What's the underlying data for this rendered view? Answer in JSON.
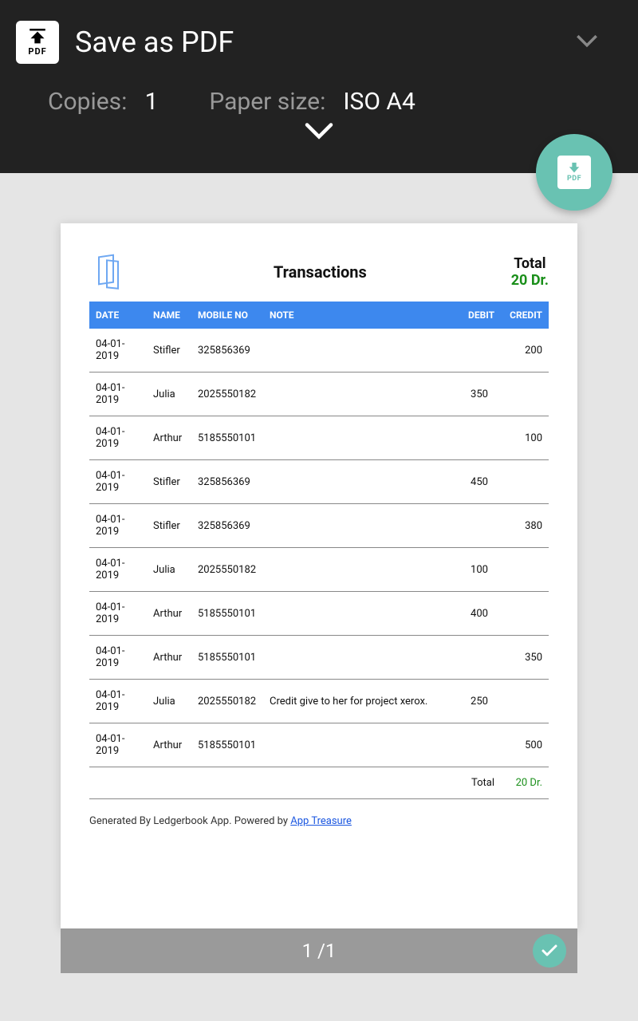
{
  "header": {
    "title": "Save as PDF",
    "copies_label": "Copies:",
    "copies_value": "1",
    "paper_label": "Paper size:",
    "paper_value": "ISO A4"
  },
  "document": {
    "title": "Transactions",
    "total_label": "Total",
    "total_value": "20 Dr.",
    "columns": {
      "date": "DATE",
      "name": "NAME",
      "mobile": "MOBILE NO",
      "note": "NOTE",
      "debit": "DEBIT",
      "credit": "CREDIT"
    },
    "rows": [
      {
        "date": "04-01-2019",
        "name": "Stifler",
        "mobile": "325856369",
        "note": "",
        "debit": "",
        "credit": "200"
      },
      {
        "date": "04-01-2019",
        "name": "Julia",
        "mobile": "2025550182",
        "note": "",
        "debit": "350",
        "credit": ""
      },
      {
        "date": "04-01-2019",
        "name": "Arthur",
        "mobile": "5185550101",
        "note": "",
        "debit": "",
        "credit": "100"
      },
      {
        "date": "04-01-2019",
        "name": "Stifler",
        "mobile": "325856369",
        "note": "",
        "debit": "450",
        "credit": ""
      },
      {
        "date": "04-01-2019",
        "name": "Stifler",
        "mobile": "325856369",
        "note": "",
        "debit": "",
        "credit": "380"
      },
      {
        "date": "04-01-2019",
        "name": "Julia",
        "mobile": "2025550182",
        "note": "",
        "debit": "100",
        "credit": ""
      },
      {
        "date": "04-01-2019",
        "name": "Arthur",
        "mobile": "5185550101",
        "note": "",
        "debit": "400",
        "credit": ""
      },
      {
        "date": "04-01-2019",
        "name": "Arthur",
        "mobile": "5185550101",
        "note": "",
        "debit": "",
        "credit": "350"
      },
      {
        "date": "04-01-2019",
        "name": "Julia",
        "mobile": "2025550182",
        "note": "Credit give to her for project xerox.",
        "debit": "250",
        "credit": ""
      },
      {
        "date": "04-01-2019",
        "name": "Arthur",
        "mobile": "5185550101",
        "note": "",
        "debit": "",
        "credit": "500"
      }
    ],
    "footer_total_label": "Total",
    "footer_total_value": "20 Dr.",
    "generated_prefix": "Generated By Ledgerbook App. Powered by ",
    "generated_link": "App Treasure"
  },
  "pager": {
    "text": "1 /1"
  }
}
